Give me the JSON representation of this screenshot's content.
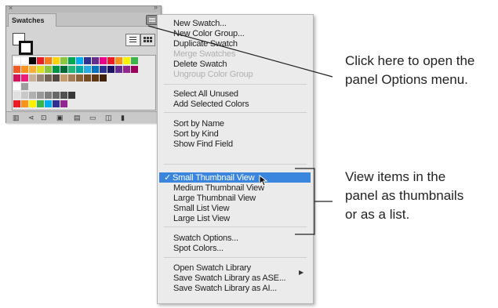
{
  "panel": {
    "tab_label": "Swatches",
    "close_glyph": "×",
    "collapse_glyph": "»"
  },
  "swatch_rows": [
    [
      "#ffffff",
      "#ffffff",
      "#000000",
      "#e61e25",
      "#f47b20",
      "#fdd20e",
      "#8dc63f",
      "#00a651",
      "#00aeef",
      "#2e3192",
      "#662d91",
      "#ec008c",
      "#ed1c24",
      "#f7941d",
      "#fff200",
      "#39b54a"
    ],
    [
      "#f15a24",
      "#f7931e",
      "#fbb03b",
      "#d9e021",
      "#8cc63f",
      "#009245",
      "#006837",
      "#22b573",
      "#00a99d",
      "#29abe2",
      "#0071bc",
      "#2e3192",
      "#1b1464",
      "#662d91",
      "#93278f",
      "#9e005d"
    ],
    [
      "#d4145a",
      "#ed1e79",
      "#c7b299",
      "#998675",
      "#736357",
      "#534741",
      "#c69c6d",
      "#a67c52",
      "#8c6239",
      "#754c24",
      "#603813",
      "#42210b"
    ],
    [
      "#ffffff",
      "#9e9e9e"
    ],
    [
      "#e0e0e0",
      "#c8c8c8",
      "#b0b0b0",
      "#989898",
      "#808080",
      "#686868",
      "#505050",
      "#383838"
    ],
    [
      "#ed1c24",
      "#f7941d",
      "#fff200",
      "#39b54a",
      "#00aeef",
      "#2e3192",
      "#92278f"
    ]
  ],
  "menu": {
    "items": [
      {
        "label": "New Swatch...",
        "disabled": false
      },
      {
        "label": "New Color Group...",
        "disabled": false
      },
      {
        "label": "Duplicate Swatch",
        "disabled": false
      },
      {
        "label": "Merge Swatches",
        "disabled": true
      },
      {
        "label": "Delete Swatch",
        "disabled": false
      },
      {
        "label": "Ungroup Color Group",
        "disabled": true
      },
      {
        "label": "Select All Unused",
        "disabled": false
      },
      {
        "label": "Add Selected Colors",
        "disabled": false
      },
      {
        "label": "Sort by Name",
        "disabled": false
      },
      {
        "label": "Sort by Kind",
        "disabled": false
      },
      {
        "label": "Show Find Field",
        "disabled": false
      },
      {
        "label": "Small Thumbnail View",
        "disabled": false,
        "checked": true
      },
      {
        "label": "Medium Thumbnail View",
        "disabled": false
      },
      {
        "label": "Large Thumbnail View",
        "disabled": false
      },
      {
        "label": "Small List View",
        "disabled": false
      },
      {
        "label": "Large List View",
        "disabled": false
      },
      {
        "label": "Swatch Options...",
        "disabled": false
      },
      {
        "label": "Spot Colors...",
        "disabled": false
      },
      {
        "label": "Open Swatch Library",
        "disabled": false,
        "submenu": true
      },
      {
        "label": "Save Swatch Library as ASE...",
        "disabled": false
      },
      {
        "label": "Save Swatch Library as AI...",
        "disabled": false
      }
    ],
    "check_glyph": "✓",
    "submenu_glyph": "▶"
  },
  "callouts": {
    "options_menu": [
      "Click here to open the",
      "panel Options menu."
    ],
    "thumbnails": [
      "View items in the",
      "panel as thumbnails",
      "or as a list."
    ]
  },
  "colors": {
    "highlight": "#3a86de",
    "menu_bg": "#ebebeb",
    "panel_bg": "#d4d4d4"
  }
}
